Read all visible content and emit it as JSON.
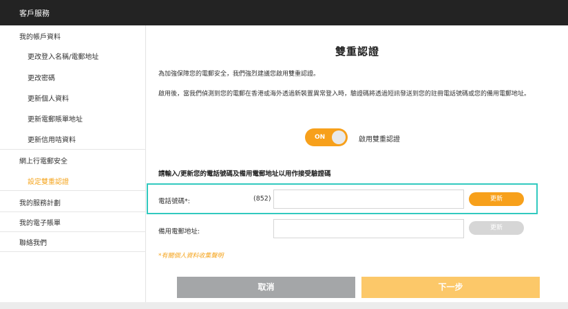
{
  "topbar": {
    "title": "客戶服務"
  },
  "sidebar": {
    "groups": [
      {
        "label": "我的帳戶資料",
        "items": [
          {
            "label": "更改登入名稱/電郵地址"
          },
          {
            "label": "更改密碼"
          },
          {
            "label": "更新個人資料"
          },
          {
            "label": "更新電郵賬單地址"
          },
          {
            "label": "更新信用咭資料"
          }
        ]
      },
      {
        "label": "網上行電郵安全",
        "items": [
          {
            "label": "設定雙重認證",
            "active": true
          }
        ]
      },
      {
        "label": "我的服務計劃"
      },
      {
        "label": "我的電子賬單"
      },
      {
        "label": "聯絡我們"
      }
    ]
  },
  "main": {
    "title": "雙重認證",
    "intro": "為加強保障您的電郵安全，我們強烈建議您啟用雙重認證。",
    "description": "啟用後，當我們偵測到您的電郵在香港或海外透過新裝置異常登入時，驗證碼將透過短訊發送到您的註冊電話號碼或您的備用電郵地址。",
    "toggle": {
      "state_label": "ON",
      "label": "啟用雙重認證",
      "enabled": true
    },
    "section_heading": "請輸入/更新您的電話號碼及備用電郵地址以用作接受驗證碼",
    "phone": {
      "label": "電話號碼*:",
      "prefix": "(852)",
      "value": "",
      "button": "更新"
    },
    "email": {
      "label": "備用電郵地址:",
      "value": "",
      "button": "更新"
    },
    "notice": "*有關個人資料收集聲明",
    "cancel": "取消",
    "next": "下一步"
  },
  "colors": {
    "accent": "#f7a01b",
    "highlight": "#30c9bf",
    "topbar": "#232323"
  }
}
